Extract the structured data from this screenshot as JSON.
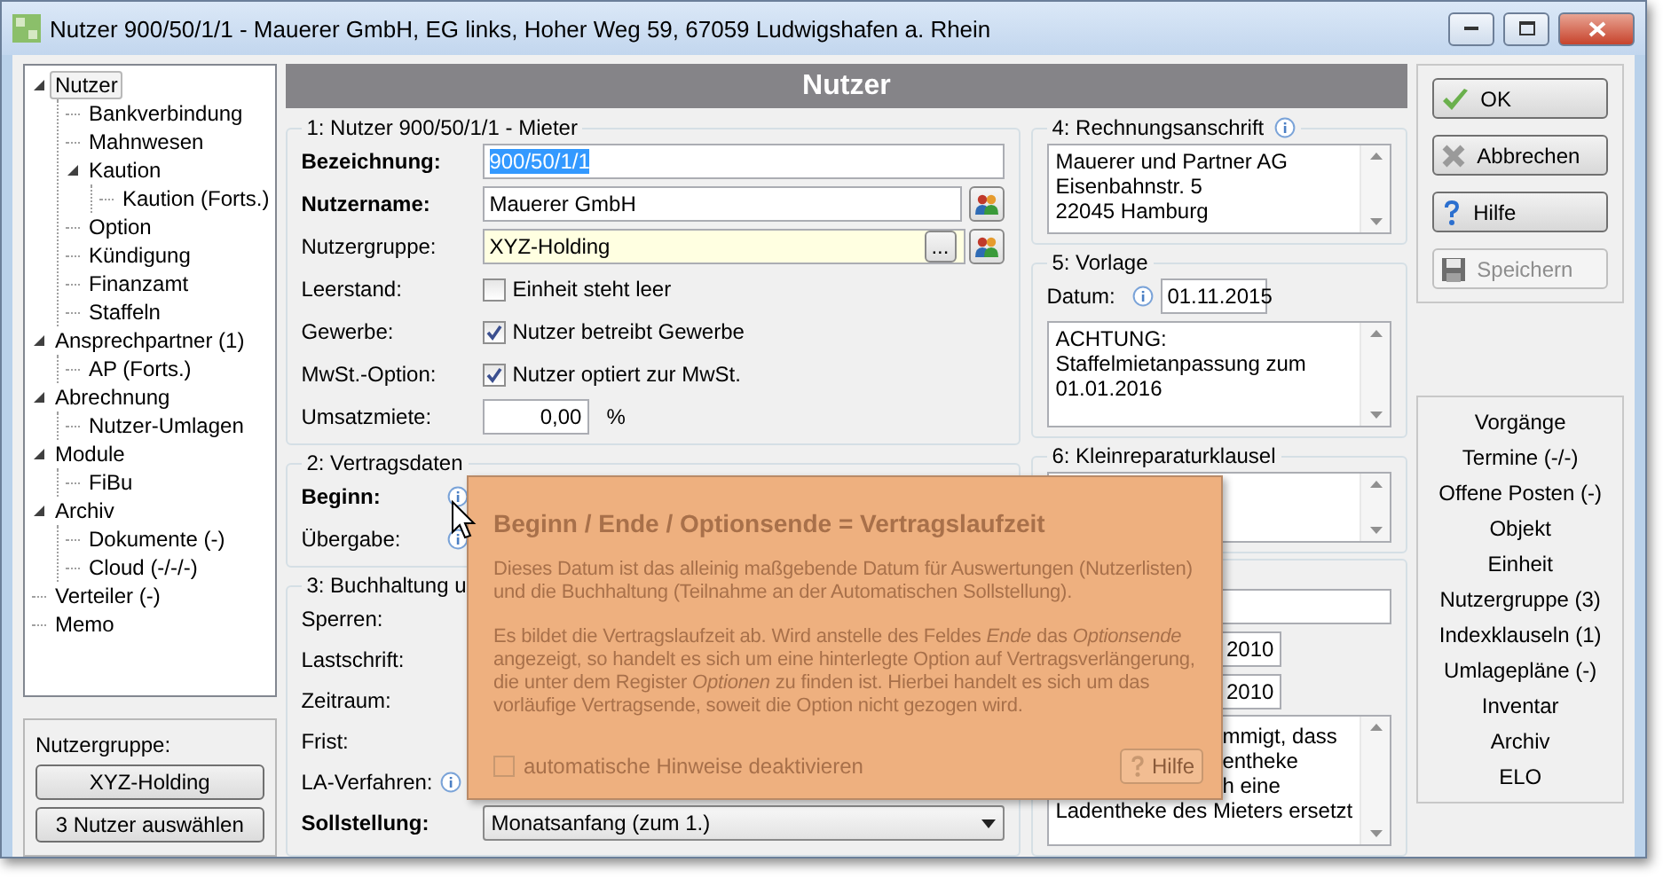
{
  "window": {
    "title": "Nutzer 900/50/1/1 - Mauerer GmbH, EG links, Hoher Weg 59, 67059 Ludwigshafen a. Rhein"
  },
  "tree": [
    {
      "label": "Nutzer",
      "selected": true,
      "expanded": true,
      "children": [
        {
          "label": "Bankverbindung",
          "selected": false
        },
        {
          "label": "Mahnwesen",
          "selected": false
        },
        {
          "label": "Kaution",
          "selected": false,
          "expanded": true,
          "children": [
            {
              "label": "Kaution (Forts.)",
              "selected": false
            }
          ]
        },
        {
          "label": "Option",
          "selected": false
        },
        {
          "label": "Kündigung",
          "selected": false
        },
        {
          "label": "Finanzamt",
          "selected": false
        },
        {
          "label": "Staffeln",
          "selected": false
        }
      ]
    },
    {
      "label": "Ansprechpartner (1)",
      "selected": false,
      "expanded": true,
      "children": [
        {
          "label": "AP (Forts.)",
          "selected": false
        }
      ]
    },
    {
      "label": "Abrechnung",
      "selected": false,
      "expanded": true,
      "children": [
        {
          "label": "Nutzer-Umlagen",
          "selected": false
        }
      ]
    },
    {
      "label": "Module",
      "selected": false,
      "expanded": true,
      "children": [
        {
          "label": "FiBu",
          "selected": false
        }
      ]
    },
    {
      "label": "Archiv",
      "selected": false,
      "expanded": true,
      "children": [
        {
          "label": "Dokumente (-)",
          "selected": false
        },
        {
          "label": "Cloud (-/-/-)",
          "selected": false
        }
      ]
    },
    {
      "label": "Verteiler (-)",
      "selected": false
    },
    {
      "label": "Memo",
      "selected": false
    }
  ],
  "group_panel": {
    "label": "Nutzergruppe:",
    "buttons": [
      "XYZ-Holding",
      "3 Nutzer auswählen"
    ]
  },
  "header": "Nutzer",
  "section_1": {
    "title": "1: Nutzer 900/50/1/1 - Mieter",
    "rows": [
      {
        "kind": "text",
        "label": "Bezeichnung:",
        "bold": true,
        "value": "900/50/1/1",
        "highlighted": true
      },
      {
        "kind": "lookup",
        "label": "Nutzername:",
        "bold": true,
        "value": "Mauerer GmbH"
      },
      {
        "kind": "picker",
        "label": "Nutzergruppe:",
        "bold": false,
        "value": "XYZ-Holding",
        "button": "..."
      },
      {
        "kind": "checkbox",
        "label": "Leerstand:",
        "bold": false,
        "text": "Einheit steht leer",
        "checked": false
      },
      {
        "kind": "checkbox",
        "label": "Gewerbe:",
        "bold": false,
        "text": "Nutzer betreibt Gewerbe",
        "checked": true
      },
      {
        "kind": "checkbox",
        "label": "MwSt.-Option:",
        "bold": false,
        "text": "Nutzer optiert zur MwSt.",
        "checked": true
      },
      {
        "kind": "number",
        "label": "Umsatzmiete:",
        "bold": false,
        "value": "0,00",
        "unit": "%"
      }
    ]
  },
  "section_2": {
    "title": "2: Vertragsdaten",
    "rows": [
      {
        "label": "Beginn:",
        "bold": true
      },
      {
        "label": "Übergabe:",
        "bold": false
      }
    ]
  },
  "section_3": {
    "title": "3: Buchhaltung u",
    "rows": [
      {
        "label": "Sperren:",
        "bold": false,
        "info": false
      },
      {
        "label": "Lastschrift:",
        "bold": false,
        "info": false
      },
      {
        "label": "Zeitraum:",
        "bold": false,
        "info": false
      },
      {
        "label": "Frist:",
        "bold": false,
        "info": false
      },
      {
        "label": "LA-Verfahren:",
        "bold": false,
        "info": true
      },
      {
        "label": "Sollstellung:",
        "bold": true,
        "info": false,
        "dropdown": "Monatsanfang (zum 1.)"
      }
    ]
  },
  "section_4": {
    "title": "4: Rechnungsanschrift",
    "lines": [
      "Mauerer und Partner AG",
      "Eisenbahnstr. 5",
      "22045 Hamburg"
    ]
  },
  "section_5": {
    "title": "5: Vorlage",
    "date_label": "Datum:",
    "date": "01.11.2015",
    "lines": [
      "ACHTUNG:",
      "Staffelmietanpassung zum",
      "01.01.2016"
    ]
  },
  "section_6": {
    "title": "6: Kleinreparaturklausel"
  },
  "section_7": {
    "fields": [
      "2010",
      "2010"
    ],
    "lines": [
      "mmigt, dass",
      "entheke",
      "h eine",
      "Ladentheke des Mieters ersetzt"
    ]
  },
  "buttons": [
    {
      "kind": "ok",
      "label": "OK",
      "disabled": false
    },
    {
      "kind": "cancel",
      "label": "Abbrechen",
      "disabled": false
    },
    {
      "kind": "help",
      "label": "Hilfe",
      "disabled": false
    },
    {
      "kind": "save",
      "label": "Speichern",
      "disabled": true
    }
  ],
  "links": [
    "Vorgänge",
    "Termine (-/-)",
    "Offene Posten (-)",
    "Objekt",
    "Einheit",
    "Nutzergruppe (3)",
    "Indexklauseln (1)",
    "Umlagepläne (-)",
    "Inventar",
    "Archiv",
    "ELO"
  ],
  "tooltip": {
    "title": "Beginn / Ende / Optionsende = Vertragslaufzeit",
    "paragraphs": [
      "Dieses Datum ist das alleinig maßgebende Datum für Auswertungen (Nutzerlisten) und die Buchhaltung (Teilnahme an der Automatischen Sollstellung).",
      "Es bildet die Vertragslaufzeit ab. Wird anstelle des Feldes *Ende* das *Optionsende* angezeigt, so handelt es sich um eine hinterlegte Option auf Vertragsverlängerung, die unter dem Register *Optionen* zu finden ist. Hierbei handelt es sich um das vorläufige Vertragsende, soweit die Option nicht gezogen wird."
    ],
    "checkbox": {
      "label": "automatische Hinweise deaktivieren",
      "checked": false
    },
    "help_button": "Hilfe"
  }
}
